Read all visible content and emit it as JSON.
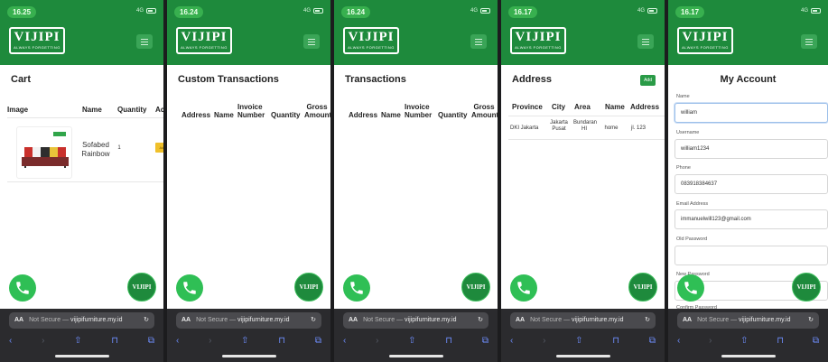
{
  "brand": {
    "logo_text": "VIJIPI",
    "logo_sub": "ALWAYS FORGETTING",
    "fab_logo_text": "VIJIPI",
    "green": "#1e8a3c",
    "accent_green": "#2a9b47"
  },
  "status": {
    "times": [
      "16.25",
      "16.24",
      "16.24",
      "16.17",
      "16.17"
    ],
    "network": "4G"
  },
  "browser": {
    "aa": "AA",
    "not_secure": "Not Secure —",
    "host": "vijipifurniture.my.id",
    "reload_icon": "↻"
  },
  "cart": {
    "title": "Cart",
    "columns": [
      "Image",
      "Name",
      "Quantity",
      "Ac"
    ],
    "items": [
      {
        "name": "Sofabed Rainbow",
        "quantity": "1",
        "action": "Add"
      }
    ]
  },
  "custom_transactions": {
    "title": "Custom Transactions",
    "columns": [
      "Address",
      "Name",
      "Invoice Number",
      "Quantity",
      "Gross Amount"
    ]
  },
  "transactions": {
    "title": "Transactions",
    "columns": [
      "Address",
      "Name",
      "Invoice Number",
      "Quantity",
      "Gross Amount"
    ]
  },
  "address": {
    "title": "Address",
    "add_label": "Add",
    "columns": [
      "Province",
      "City",
      "Area",
      "Name",
      "Address"
    ],
    "rows": [
      {
        "province": "DKI Jakarta",
        "city": "Jakarta Pusat",
        "area": "Bundaran HI",
        "name": "home",
        "address": "jl. 123"
      }
    ]
  },
  "account": {
    "title": "My Account",
    "fields": [
      {
        "label": "Name",
        "value": "william"
      },
      {
        "label": "Username",
        "value": "william1234"
      },
      {
        "label": "Phone",
        "value": "083918384637"
      },
      {
        "label": "Email Address",
        "value": "immanuelwill123@gmail.com"
      },
      {
        "label": "Old Password",
        "value": ""
      },
      {
        "label": "New Password",
        "value": ""
      },
      {
        "label": "Confirm Password",
        "value": ""
      }
    ]
  }
}
